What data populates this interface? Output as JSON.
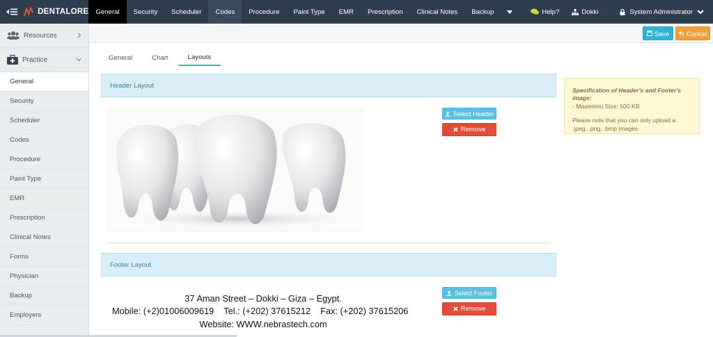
{
  "app": {
    "brand": "DENTALORE"
  },
  "nav": {
    "items": [
      {
        "label": "General"
      },
      {
        "label": "Security"
      },
      {
        "label": "Scheduler"
      },
      {
        "label": "Codes"
      },
      {
        "label": "Procedure"
      },
      {
        "label": "Paint Type"
      },
      {
        "label": "EMR"
      },
      {
        "label": "Prescription"
      },
      {
        "label": "Clinical Notes"
      },
      {
        "label": "Backup"
      }
    ],
    "help_label": "Help?",
    "branch_label": "Dokki",
    "user_label": "System Administrator"
  },
  "sidebar": {
    "groups": [
      {
        "label": "Resources"
      },
      {
        "label": "Practice"
      }
    ],
    "items": [
      {
        "label": "General"
      },
      {
        "label": "Security"
      },
      {
        "label": "Scheduler"
      },
      {
        "label": "Codes"
      },
      {
        "label": "Procedure"
      },
      {
        "label": "Paint Type"
      },
      {
        "label": "EMR"
      },
      {
        "label": "Prescription"
      },
      {
        "label": "Clinical Notes"
      },
      {
        "label": "Forms"
      },
      {
        "label": "Physician"
      },
      {
        "label": "Backup"
      },
      {
        "label": "Employers"
      }
    ]
  },
  "toolbar": {
    "save_label": "Save",
    "cancel_label": "Cancel"
  },
  "tabs": [
    {
      "label": "General"
    },
    {
      "label": "Chart"
    },
    {
      "label": "Layouts"
    }
  ],
  "header_section": {
    "title": "Header Layout",
    "select_label": "Select Header",
    "remove_label": "Remove"
  },
  "footer_section": {
    "title": "Footer Layout",
    "select_label": "Select Footer",
    "remove_label": "Remove",
    "image_text": {
      "line1": "37 Aman Street – Dokki – Giza – Egypt.",
      "mobile": "Mobile: (+2)01006009619",
      "tel": "Tel.: (+202) 37615212",
      "fax": "Fax: (+202) 37615206",
      "website": "Website: WWW.nebrastech.com"
    }
  },
  "spec": {
    "title": "Specification of Header's and Footer's image:",
    "size_line": "- Maximimu Size: 500 KB",
    "note_line1": "Please note that you can only upload a",
    "note_line2": ".jpeg, .png, .bmp images"
  },
  "colors": {
    "topbar": "#2f3e4e",
    "active_tab": "#2ec6a4",
    "save": "#33b3d6",
    "cancel": "#f0a23a",
    "remove": "#e24c3b",
    "section_head": "#d9edf7",
    "spec_bg": "#fcf7d5"
  },
  "icons": {
    "menu": "menu-toggle-icon",
    "brand": "dentalore-logo-icon",
    "help": "chat-icon",
    "branch": "sitemap-icon",
    "user": "lock-icon",
    "resources": "users-icon",
    "practice": "medkit-icon",
    "save": "floppy-icon",
    "cancel": "undo-icon",
    "select": "upload-icon",
    "remove": "close-icon"
  }
}
